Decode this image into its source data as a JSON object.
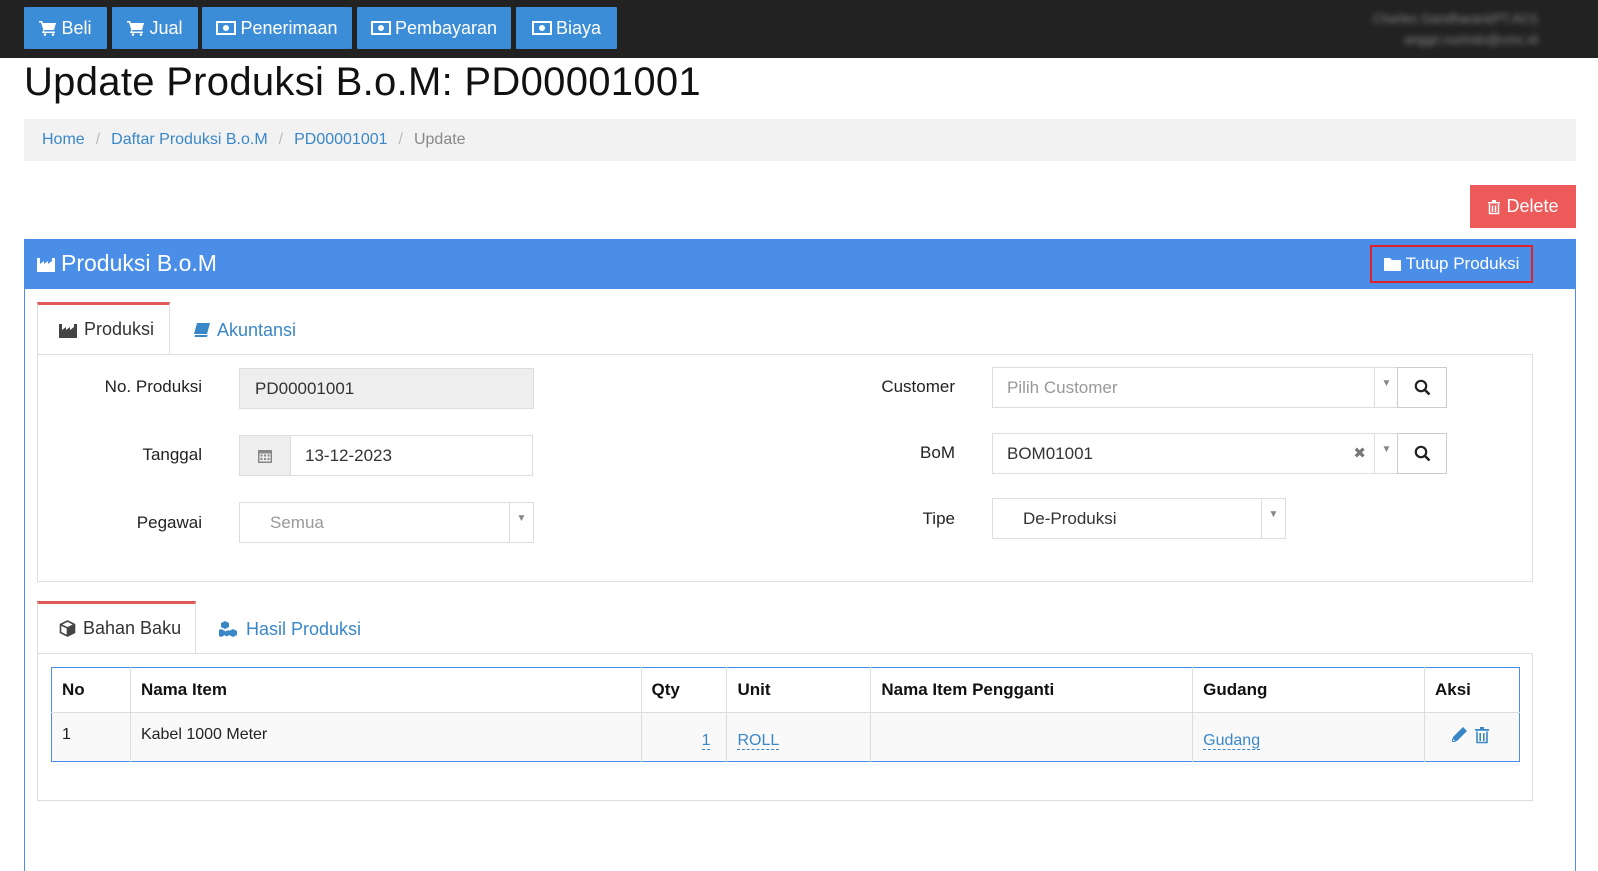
{
  "nav": {
    "buttons": [
      {
        "label": "Beli",
        "icon": "cart-icon"
      },
      {
        "label": "Jual",
        "icon": "cart-icon"
      },
      {
        "label": "Penerimaan",
        "icon": "money-icon"
      },
      {
        "label": "Pembayaran",
        "icon": "money-icon"
      },
      {
        "label": "Biaya",
        "icon": "money-icon"
      }
    ],
    "user_name": "Charles Gandharani(PT.ACI)",
    "user_email": "anggri.nurindo@cmc.id"
  },
  "page_title": "Update Produksi B.o.M: PD00001001",
  "breadcrumb": {
    "home": "Home",
    "list": "Daftar Produksi B.o.M",
    "record": "PD00001001",
    "current": "Update"
  },
  "delete_label": "Delete",
  "panel": {
    "title": "Produksi B.o.M",
    "close_label": "Tutup Produksi"
  },
  "tabs_main": {
    "produksi": "Produksi",
    "akuntansi": "Akuntansi"
  },
  "form": {
    "no_produksi_label": "No. Produksi",
    "no_produksi_value": "PD00001001",
    "tanggal_label": "Tanggal",
    "tanggal_value": "13-12-2023",
    "pegawai_label": "Pegawai",
    "pegawai_value": "Semua",
    "customer_label": "Customer",
    "customer_placeholder": "Pilih Customer",
    "bom_label": "BoM",
    "bom_value": "BOM01001",
    "tipe_label": "Tipe",
    "tipe_value": "De-Produksi"
  },
  "tabs_items": {
    "bahan_baku": "Bahan Baku",
    "hasil_produksi": "Hasil Produksi"
  },
  "table": {
    "columns": [
      "No",
      "Nama Item",
      "Qty",
      "Unit",
      "Nama Item Pengganti",
      "Gudang",
      "Aksi"
    ],
    "rows": [
      {
        "no": "1",
        "nama_item": "Kabel 1000 Meter",
        "qty": "1",
        "unit": "ROLL",
        "pengganti": "",
        "gudang": "Gudang"
      }
    ]
  },
  "colors": {
    "nav_button": "#3c8dd8",
    "panel_header": "#4a8ee8",
    "delete": "#ec5a5a",
    "highlight_box": "#e0202a",
    "link": "#3a87c8"
  }
}
